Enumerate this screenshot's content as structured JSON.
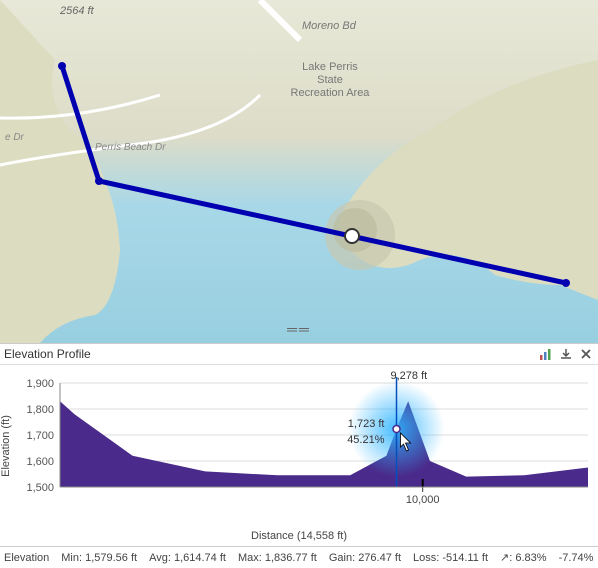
{
  "map": {
    "elevation_callout": "2564 ft",
    "labels": {
      "park": "Lake Perris\nState\nRecreation Area",
      "road1": "Moreno Bd",
      "road2": "Perris Beach Dr",
      "road3": "e Dr"
    }
  },
  "panel": {
    "title": "Elevation Profile"
  },
  "chart_data": {
    "type": "area",
    "xlabel": "Distance (14,558 ft)",
    "ylabel": "Elevation (ft)",
    "ylim": [
      1500,
      1900
    ],
    "yticks": [
      1500,
      1600,
      1700,
      1800,
      1900
    ],
    "xticks": [
      10000
    ],
    "xtick_labels": [
      "10,000"
    ],
    "xlim": [
      0,
      14558
    ],
    "hover": {
      "distance_label": "9,278 ft",
      "elevation_label": "1,723 ft",
      "slope_label": "45.21%"
    },
    "series": [
      {
        "name": "elevation",
        "x": [
          0,
          400,
          2000,
          4000,
          6000,
          8000,
          9000,
          9278,
          9600,
          10200,
          11200,
          12800,
          14558
        ],
        "values": [
          1830,
          1780,
          1620,
          1560,
          1545,
          1545,
          1620,
          1723,
          1830,
          1600,
          1540,
          1545,
          1575
        ]
      }
    ]
  },
  "stats": {
    "title": "Elevation",
    "min": "Min: 1,579.56 ft",
    "avg": "Avg: 1,614.74 ft",
    "max": "Max: 1,836.77 ft",
    "gain": "Gain: 276.47 ft",
    "loss": "Loss: -514.11 ft",
    "up_slope": "↗: 6.83%",
    "down_slope": "-7.74%"
  }
}
